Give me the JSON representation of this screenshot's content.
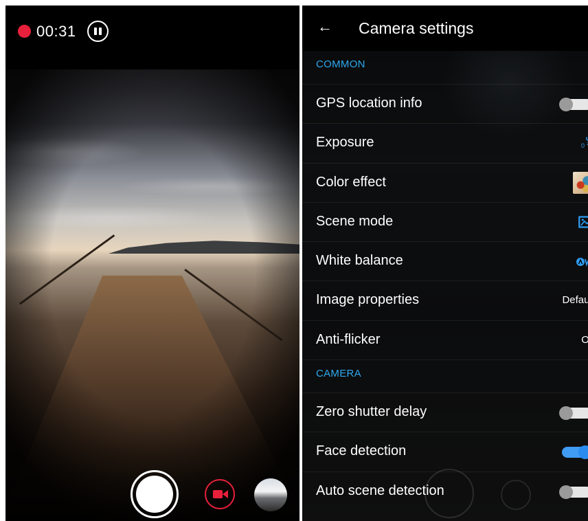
{
  "recording": {
    "elapsed": "00:31"
  },
  "settings": {
    "title": "Camera settings",
    "sections": [
      {
        "header": "COMMON",
        "rows": [
          {
            "label": "GPS location info",
            "control": "toggle",
            "on": false
          },
          {
            "label": "Exposure",
            "control": "exposure-icon"
          },
          {
            "label": "Color effect",
            "control": "color-effect-icon"
          },
          {
            "label": "Scene mode",
            "control": "scene-mode-icon"
          },
          {
            "label": "White balance",
            "control": "white-balance-auto-icon"
          },
          {
            "label": "Image properties",
            "control": "value",
            "value": "Default"
          },
          {
            "label": "Anti-flicker",
            "control": "value",
            "value": "Off"
          }
        ]
      },
      {
        "header": "CAMERA",
        "rows": [
          {
            "label": "Zero shutter delay",
            "control": "toggle",
            "on": false
          },
          {
            "label": "Face detection",
            "control": "toggle",
            "on": true
          },
          {
            "label": "Auto scene detection",
            "control": "toggle",
            "on": false
          }
        ]
      }
    ]
  },
  "colors": {
    "record_red": "#e8203b",
    "accent_blue": "#2ea9ef",
    "toggle_on": "#2a8cef"
  }
}
